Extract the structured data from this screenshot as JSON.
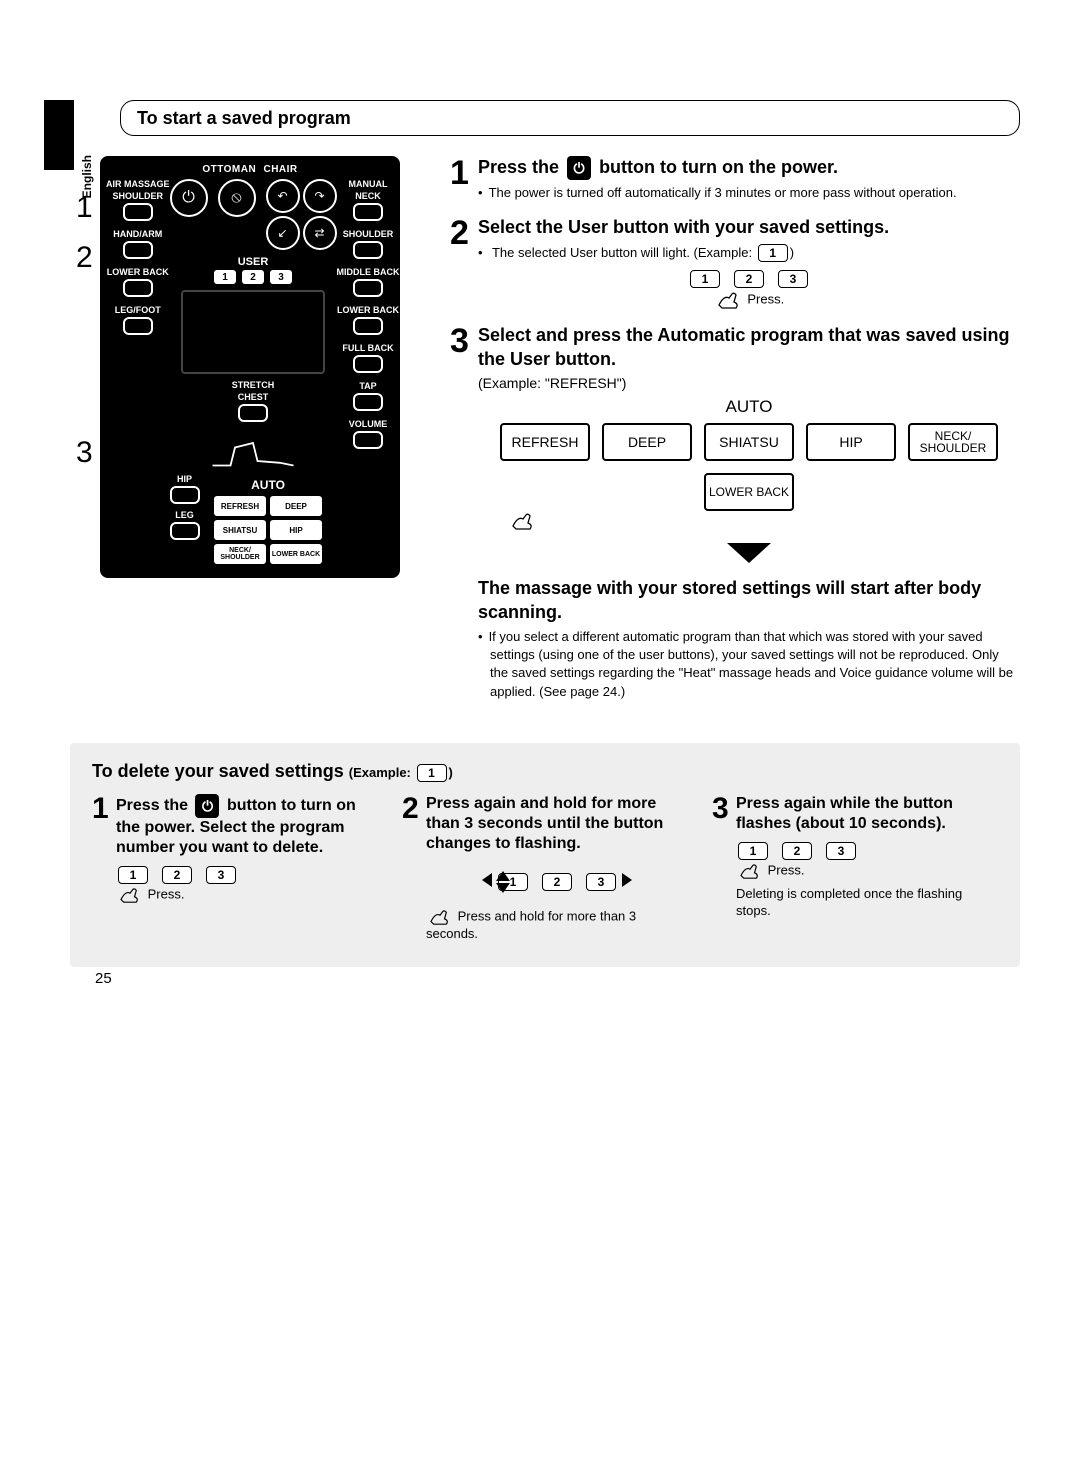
{
  "language": "English",
  "section_title": "To start a saved program",
  "remote": {
    "top_row": {
      "ottoman": "OTTOMAN",
      "chair": "CHAIR"
    },
    "left_col": [
      "AIR MASSAGE",
      "SHOULDER",
      "HAND/ARM",
      "LOWER BACK",
      "LEG/FOOT"
    ],
    "right_col": [
      "MANUAL",
      "NECK",
      "SHOULDER",
      "MIDDLE BACK",
      "LOWER BACK",
      "FULL BACK",
      "TAP",
      "VOLUME"
    ],
    "user_label": "USER",
    "user_nums": [
      "1",
      "2",
      "3"
    ],
    "stretch": "STRETCH",
    "chest": "CHEST",
    "hip": "HIP",
    "leg": "LEG",
    "auto_label": "AUTO",
    "auto_buttons": [
      "REFRESH",
      "DEEP",
      "SHIATSU",
      "HIP",
      "NECK/\nSHOULDER",
      "LOWER BACK"
    ]
  },
  "callouts": [
    "1",
    "2",
    "3"
  ],
  "steps": {
    "s1": {
      "num": "1",
      "before": "Press the ",
      "after": " button to turn on the power.",
      "bullet": "The power is turned off automatically if 3 minutes or more pass without operation."
    },
    "s2": {
      "num": "2",
      "title": "Select the User button with your saved settings.",
      "bullet_before": "The selected User button will light. (Example: ",
      "bullet_after": ")",
      "example_key": "1",
      "keys": [
        "1",
        "2",
        "3"
      ],
      "press": "Press."
    },
    "s3": {
      "num": "3",
      "title": "Select and press the Automatic program that was saved using the User button.",
      "example": "(Example: \"REFRESH\")",
      "auto_label": "AUTO",
      "buttons": [
        "REFRESH",
        "DEEP",
        "SHIATSU",
        "HIP",
        "NECK/\nSHOULDER",
        "LOWER BACK"
      ]
    },
    "result": {
      "title": "The massage with your stored settings will start after body scanning.",
      "bullet": "If you select a different automatic program than that which was stored with your saved settings (using one of the user buttons), your saved settings will not be reproduced. Only the saved settings regarding the \"Heat\" massage heads and Voice guidance volume will be applied. (See page 24.)"
    }
  },
  "delete": {
    "header_main": "To delete your saved settings ",
    "header_eg_before": "(Example: ",
    "header_eg_key": "1",
    "header_eg_after": ")",
    "c1": {
      "num": "1",
      "text_before": "Press the ",
      "text_after": " button to turn on the power. Select the program number you want to delete.",
      "keys": [
        "1",
        "2",
        "3"
      ],
      "press": "Press."
    },
    "c2": {
      "num": "2",
      "text": "Press again and hold for more than 3 seconds until the button changes to flashing.",
      "keys": [
        "1",
        "2",
        "3"
      ],
      "note": "Press and hold for more than 3 seconds."
    },
    "c3": {
      "num": "3",
      "text": "Press again while the button flashes (about 10 seconds).",
      "keys": [
        "1",
        "2",
        "3"
      ],
      "press": "Press.",
      "note": "Deleting is completed once the flashing stops."
    }
  },
  "page_number": "25"
}
